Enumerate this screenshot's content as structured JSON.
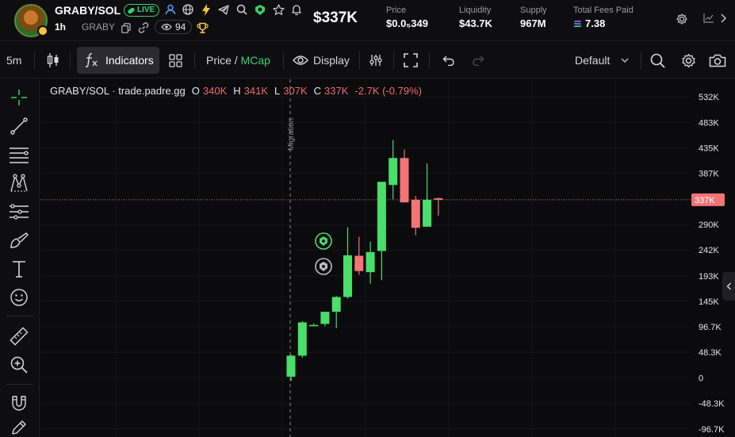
{
  "header": {
    "pair": "GRABY/SOL",
    "live_label": "LIVE",
    "timeframe": "1h",
    "ticker": "GRABY",
    "views": "94",
    "market_cap": "$337K",
    "stats": [
      {
        "label": "Price",
        "value": "$0.0₅349"
      },
      {
        "label": "Liquidity",
        "value": "$43.7K"
      },
      {
        "label": "Supply",
        "value": "967M"
      },
      {
        "label": "Total Fees Paid",
        "value": "7.38"
      }
    ],
    "icons": [
      "person-icon",
      "globe-icon",
      "lightning-icon",
      "telegram-icon",
      "search-icon",
      "badge-icon",
      "star-icon",
      "bell-icon",
      "copy-icon",
      "link-icon",
      "eye-icon",
      "trophy-icon",
      "solana-icon",
      "gear-icon",
      "chart-icon",
      "chevron-right-icon"
    ]
  },
  "toolbar": {
    "interval": "5m",
    "indicators_label": "Indicators",
    "price_label": "Price",
    "separator": " / ",
    "mcap_label": "MCap",
    "display_label": "Display",
    "layout_label": "Default",
    "icons": [
      "candles-icon",
      "fx-icon",
      "grid-icon",
      "eye-icon",
      "compare-icon",
      "fullscreen-icon",
      "undo-icon",
      "redo-icon",
      "chevron-down-icon",
      "search-icon",
      "gear-icon",
      "camera-icon"
    ]
  },
  "tools": [
    "crosshair-icon",
    "trendline-icon",
    "horizontal-lines-icon",
    "pattern-icon",
    "measure-lines-icon",
    "brush-icon",
    "text-icon",
    "emoji-icon",
    "ruler-icon",
    "zoom-in-icon",
    "magnet-icon",
    "pencil-icon"
  ],
  "legend": {
    "title": "GRABY/SOL · trade.padre.gg",
    "o_key": "O",
    "o_val": "340K",
    "h_key": "H",
    "h_val": "341K",
    "l_key": "L",
    "l_val": "307K",
    "c_key": "C",
    "c_val": "337K",
    "change": "-2.7K (-0.79%)"
  },
  "chart": {
    "migration_label": "Migration",
    "current_price_label": "337K",
    "current_price": 337,
    "y_ticks": [
      {
        "label": "532K",
        "v": 532
      },
      {
        "label": "483K",
        "v": 483
      },
      {
        "label": "435K",
        "v": 435
      },
      {
        "label": "387K",
        "v": 387
      },
      {
        "label": "290K",
        "v": 290
      },
      {
        "label": "242K",
        "v": 242
      },
      {
        "label": "193K",
        "v": 193
      },
      {
        "label": "145K",
        "v": 145
      },
      {
        "label": "96.7K",
        "v": 96.7
      },
      {
        "label": "48.3K",
        "v": 48.3
      },
      {
        "label": "0",
        "v": 0
      },
      {
        "label": "-48.3K",
        "v": -48.3
      },
      {
        "label": "-96.7K",
        "v": -96.7
      }
    ],
    "colors": {
      "up": "#4ade6a",
      "down": "#f27474",
      "grid": "#16161b",
      "price_line": "#f27474",
      "axis_text": "#e6e6e6"
    }
  },
  "chart_data": {
    "type": "candlestick",
    "title": "GRABY/SOL · trade.padre.gg",
    "y_unit": "K",
    "ylim": [
      -112,
      565
    ],
    "series": [
      {
        "name": "GRABY/SOL",
        "candles": [
          {
            "o": 2,
            "h": 44,
            "l": -6,
            "c": 42
          },
          {
            "o": 42,
            "h": 107,
            "l": 38,
            "c": 105
          },
          {
            "o": 100,
            "h": 103,
            "l": 98,
            "c": 100
          },
          {
            "o": 102,
            "h": 125,
            "l": 98,
            "c": 125
          },
          {
            "o": 125,
            "h": 155,
            "l": 94,
            "c": 153
          },
          {
            "o": 153,
            "h": 285,
            "l": 150,
            "c": 232
          },
          {
            "o": 231,
            "h": 267,
            "l": 195,
            "c": 202
          },
          {
            "o": 200,
            "h": 258,
            "l": 178,
            "c": 238
          },
          {
            "o": 240,
            "h": 284,
            "l": 185,
            "c": 371
          },
          {
            "o": 365,
            "h": 450,
            "l": 338,
            "c": 416
          },
          {
            "o": 416,
            "h": 432,
            "l": 332,
            "c": 332
          },
          {
            "o": 337,
            "h": 344,
            "l": 270,
            "c": 284
          },
          {
            "o": 286,
            "h": 406,
            "l": 286,
            "c": 337
          },
          {
            "o": 340,
            "h": 341,
            "l": 307,
            "c": 337
          }
        ]
      }
    ],
    "price_line": 337
  }
}
